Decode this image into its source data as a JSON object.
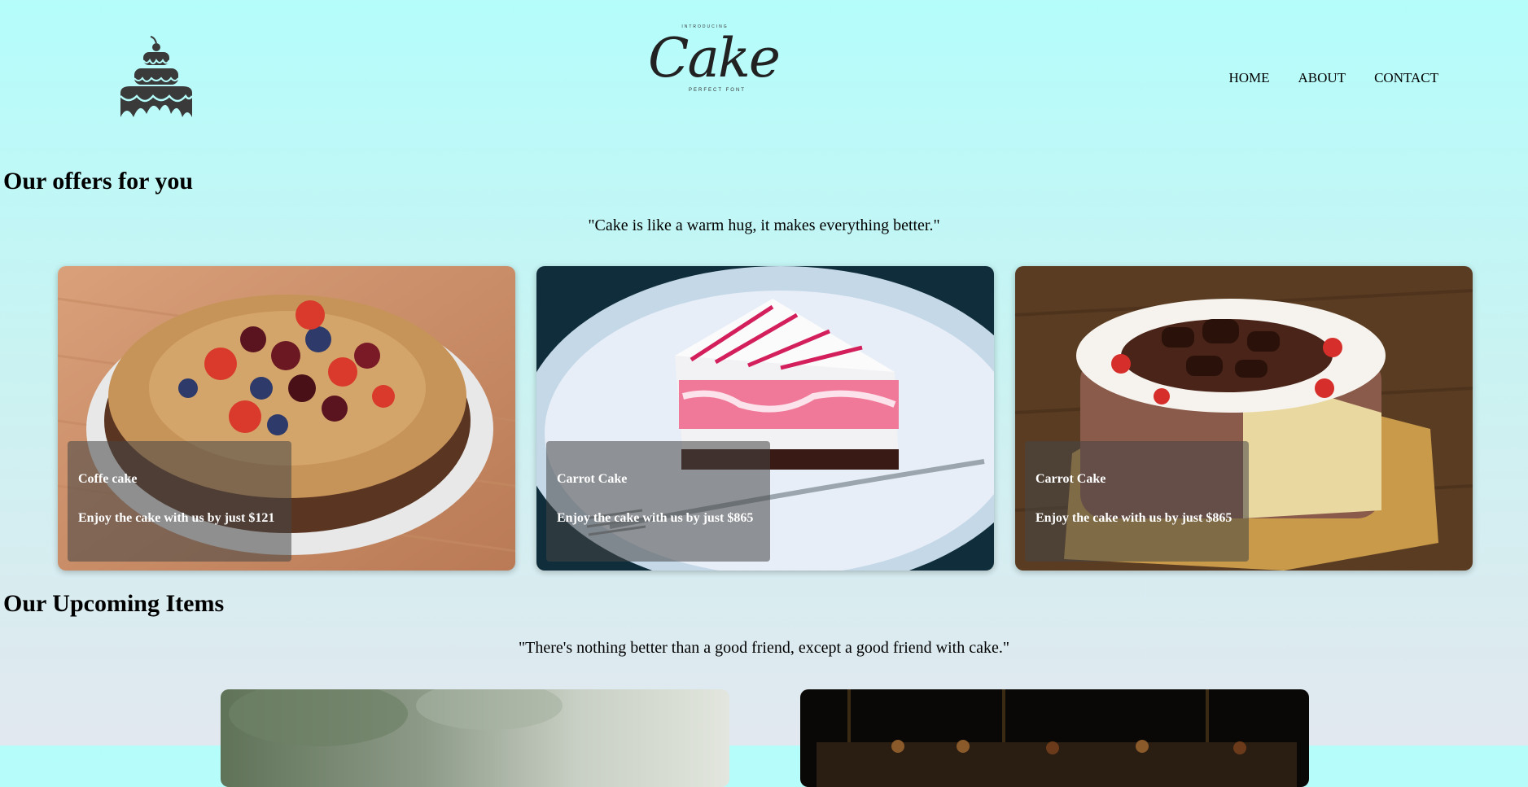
{
  "header": {
    "logo_left_icon": "cake-icon",
    "logo": {
      "intro": "INTRODUCING",
      "word": "Cake",
      "sub": "PERFECT FONT"
    },
    "nav": [
      {
        "label": "HOME"
      },
      {
        "label": "ABOUT"
      },
      {
        "label": "CONTACT"
      }
    ]
  },
  "offers": {
    "title": "Our offers for you",
    "quote": "\"Cake is like a warm hug, it makes everything better.\"",
    "cards": [
      {
        "name": "Coffe cake",
        "price_text": "Enjoy the cake with us by just $121"
      },
      {
        "name": "Carrot Cake",
        "price_text": "Enjoy the cake with us by just $865"
      },
      {
        "name": "Carrot Cake",
        "price_text": "Enjoy the cake with us by just $865"
      }
    ]
  },
  "upcoming": {
    "title": "Our Upcoming Items",
    "quote": "\"There's nothing better than a good friend, except a good friend with cake.\""
  },
  "colors": {
    "background_top": "#b4fdfb",
    "background_bottom": "#e2e8f0",
    "caption_overlay": "rgba(70,70,70,0.55)"
  }
}
